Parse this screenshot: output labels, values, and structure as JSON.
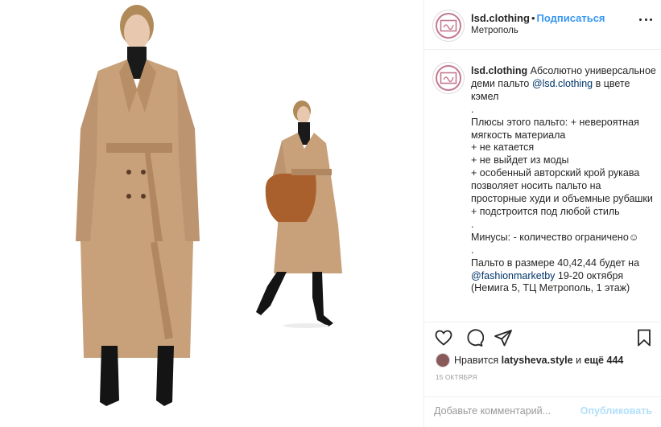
{
  "post": {
    "username": "lsd.clothing",
    "dot": "•",
    "follow_label": "Подписаться",
    "location": "Метрополь"
  },
  "caption": {
    "username": "lsd.clothing",
    "intro": "Абсолютно универсальное деми пальто",
    "mention_brand": "@lsd.clothing",
    "color_text": "в цвете кэмел",
    "sep": ".",
    "pros_intro": "Плюсы этого пальто: + невероятная мягкость материала",
    "pro_1": "+ не катается",
    "pro_2": "+ не выйдет из моды",
    "pro_3": "+ особенный авторский крой рукава позволяет носить пальто на просторные худи и объемные рубашки",
    "pro_4": "+ подстроится под любой стиль",
    "cons": "Минусы: - количество ограничено☺",
    "sizes": "Пальто в размере 40,42,44 будет на",
    "mention_market": "@fashionmarketby",
    "dates": "19-20 октября",
    "address": "(Немига 5, ТЦ Метрополь, 1 этаж)"
  },
  "likes": {
    "prefix": "Нравится",
    "user": "latysheva.style",
    "and": "и",
    "more": "ещё 444"
  },
  "date": "15 ОКТЯБРЯ",
  "comment_box": {
    "placeholder": "Добавьте комментарий...",
    "publish": "Опубликовать"
  },
  "icons": {
    "like": "heart-icon",
    "comment": "comment-icon",
    "share": "share-icon",
    "save": "bookmark-icon",
    "more": "more-icon"
  },
  "colors": {
    "link": "#003569",
    "follow": "#3897f0",
    "coat": "#c8a07a",
    "avatar_ring": "#c4798f"
  }
}
